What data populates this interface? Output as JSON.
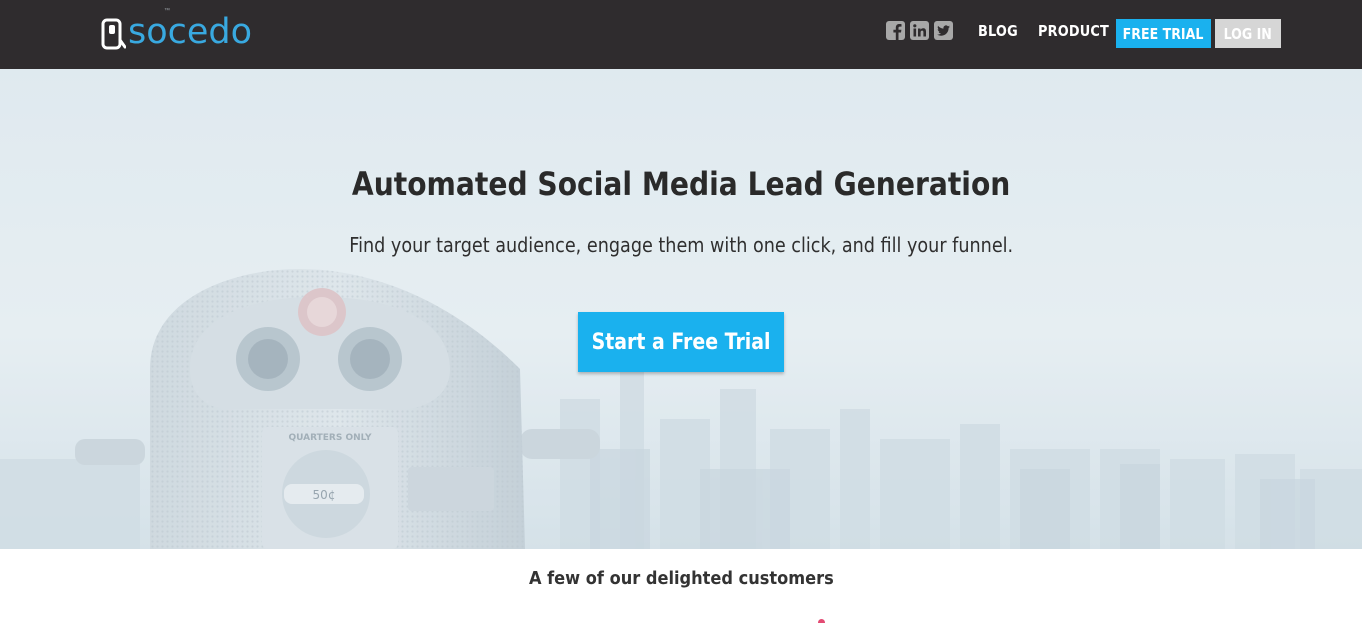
{
  "brand": {
    "name": "socedo",
    "trademark": "™",
    "logo_color": "#39a9e0"
  },
  "nav": {
    "social": [
      {
        "icon": "facebook-icon"
      },
      {
        "icon": "linkedin-icon"
      },
      {
        "icon": "twitter-icon"
      }
    ],
    "blog_label": "BLOG",
    "product_label": "PRODUCT",
    "free_trial_label": "FREE TRIAL",
    "login_label": "LOG IN"
  },
  "hero": {
    "title": "Automated Social Media Lead Generation",
    "subtitle": "Find your target audience, engage them with one click, and fill your funnel.",
    "cta_label": "Start a Free Trial",
    "binocular_sign": "QUARTERS ONLY",
    "binocular_price": "50¢"
  },
  "customers": {
    "title": "A few of our delighted customers"
  },
  "colors": {
    "navbar_bg": "#2f2c2e",
    "accent": "#1ab1ee",
    "login_bg": "#d6d6d6"
  }
}
